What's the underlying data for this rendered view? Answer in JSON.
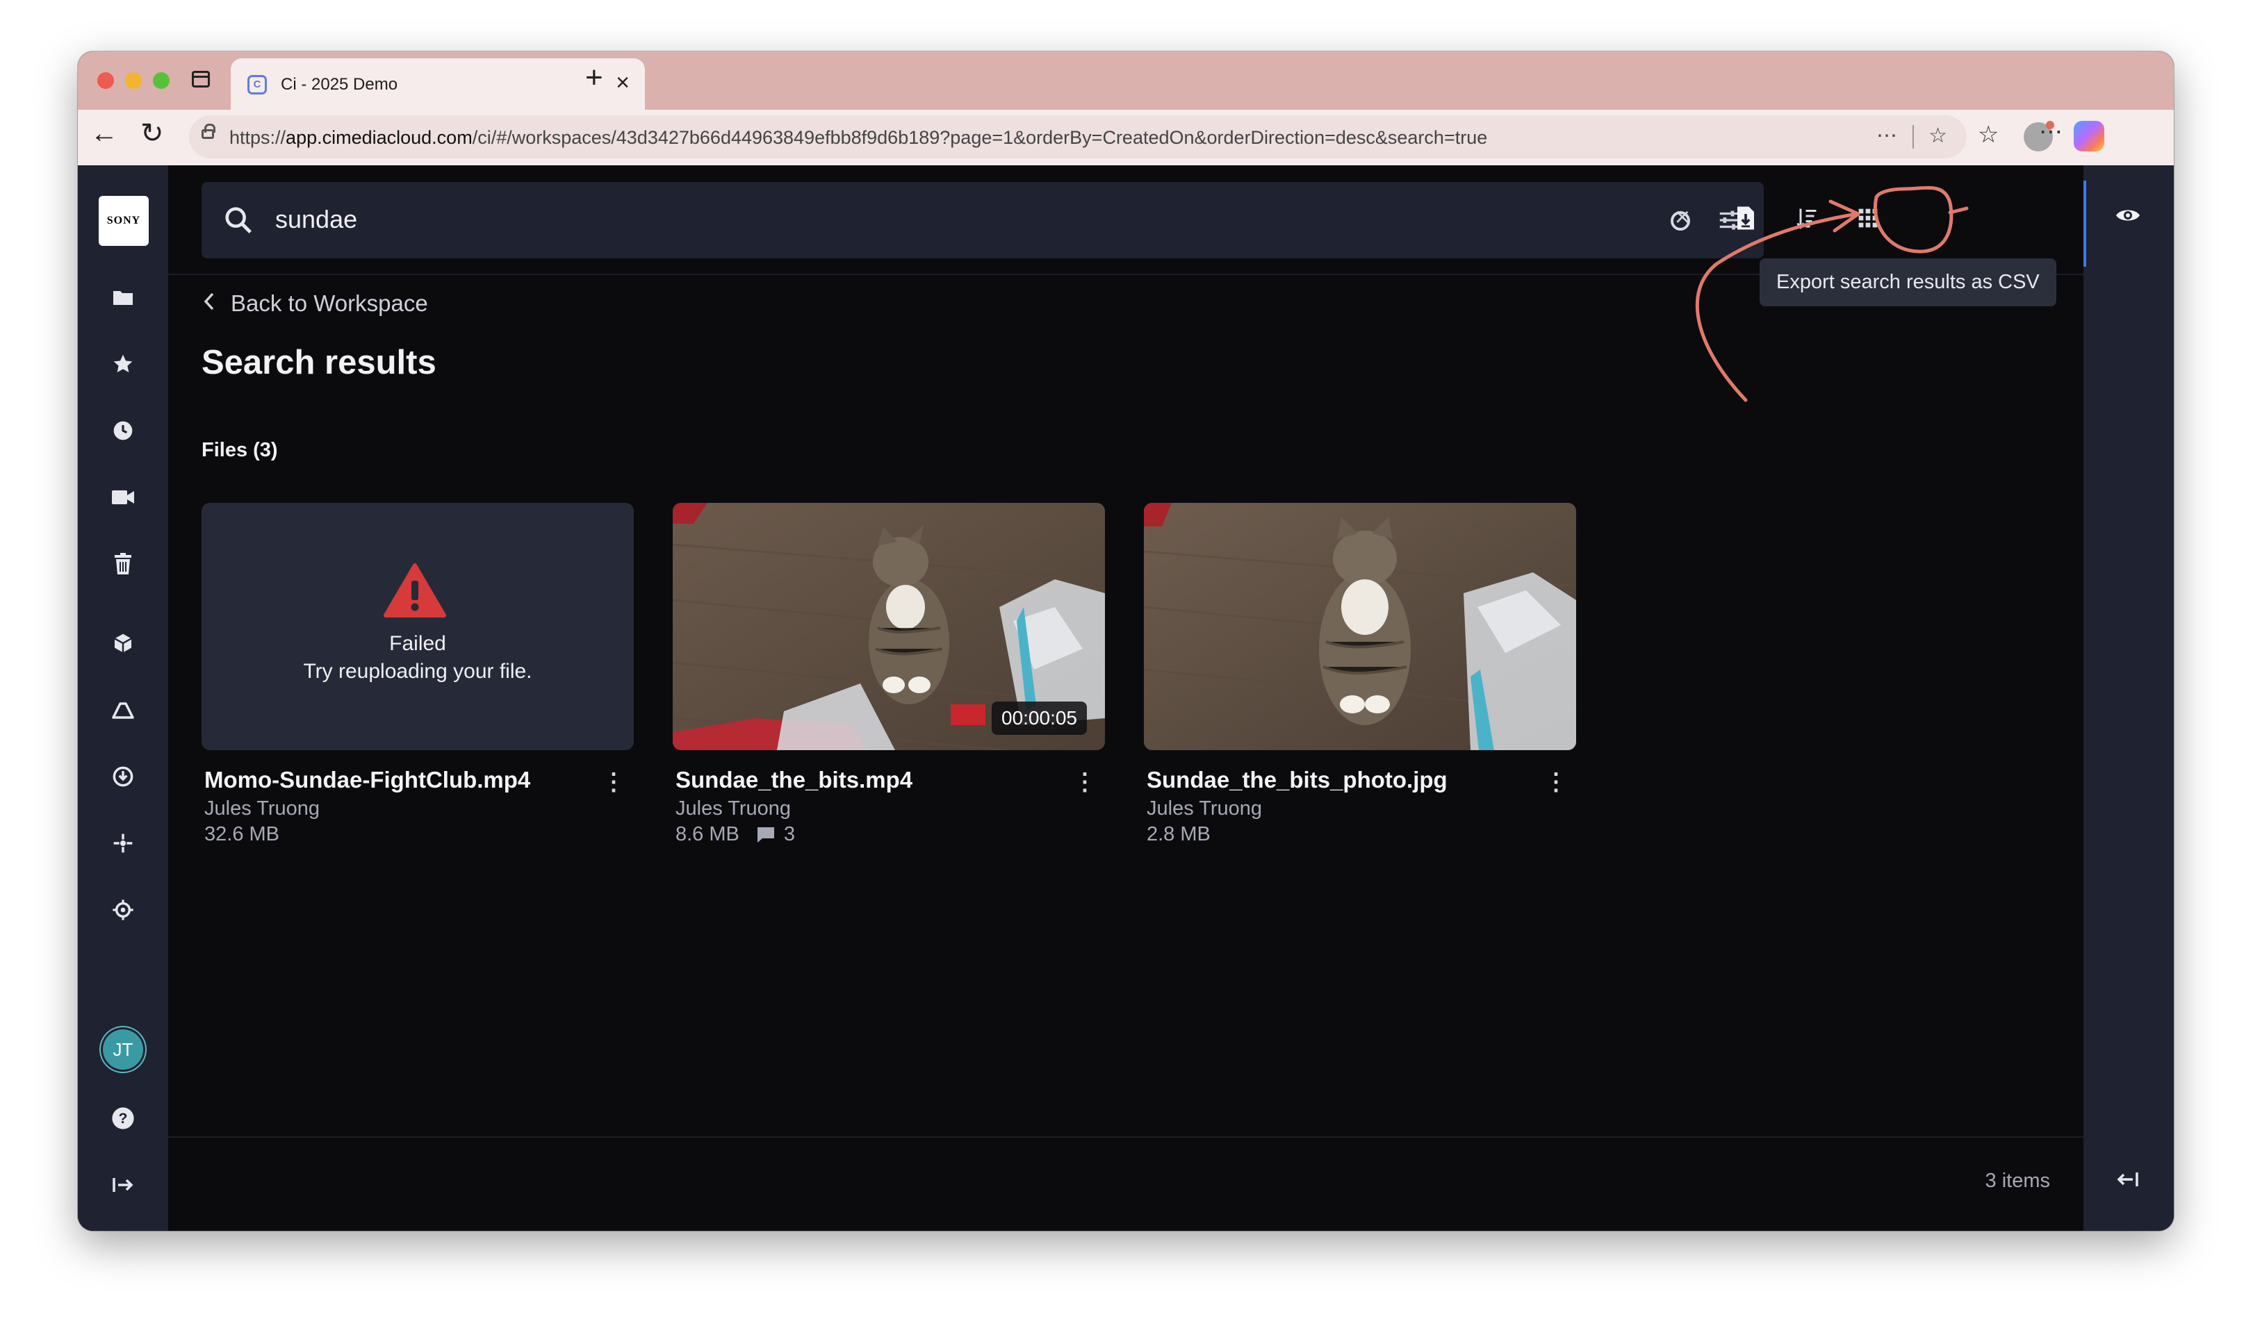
{
  "browser": {
    "tab_title": "Ci - 2025 Demo",
    "url_prefix": "https://",
    "url_domain": "app.cimediacloud.com",
    "url_rest": "/ci/#/workspaces/43d3427b66d44963849efbb8f9d6b189?page=1&orderBy=CreatedOn&orderDirection=desc&search=true"
  },
  "app": {
    "logo_text": "SONY",
    "avatar_initials": "JT",
    "search": {
      "value": "sundae"
    },
    "tooltip": "Export search results as CSV",
    "back_label": "Back to Workspace",
    "page_title": "Search results",
    "files_label": "Files (3)",
    "files": [
      {
        "name": "Momo-Sundae-FightClub.mp4",
        "owner": "Jules Truong",
        "size": "32.6 MB",
        "failed_title": "Failed",
        "failed_sub": "Try reuploading your file."
      },
      {
        "name": "Sundae_the_bits.mp4",
        "owner": "Jules Truong",
        "size": "8.6 MB",
        "comments": "3",
        "duration": "00:00:05"
      },
      {
        "name": "Sundae_the_bits_photo.jpg",
        "owner": "Jules Truong",
        "size": "2.8 MB"
      }
    ],
    "items_count": "3 items"
  },
  "colors": {
    "accent": "#3a7af0",
    "warning": "#d63a3a",
    "annotation": "#e07a6a"
  }
}
